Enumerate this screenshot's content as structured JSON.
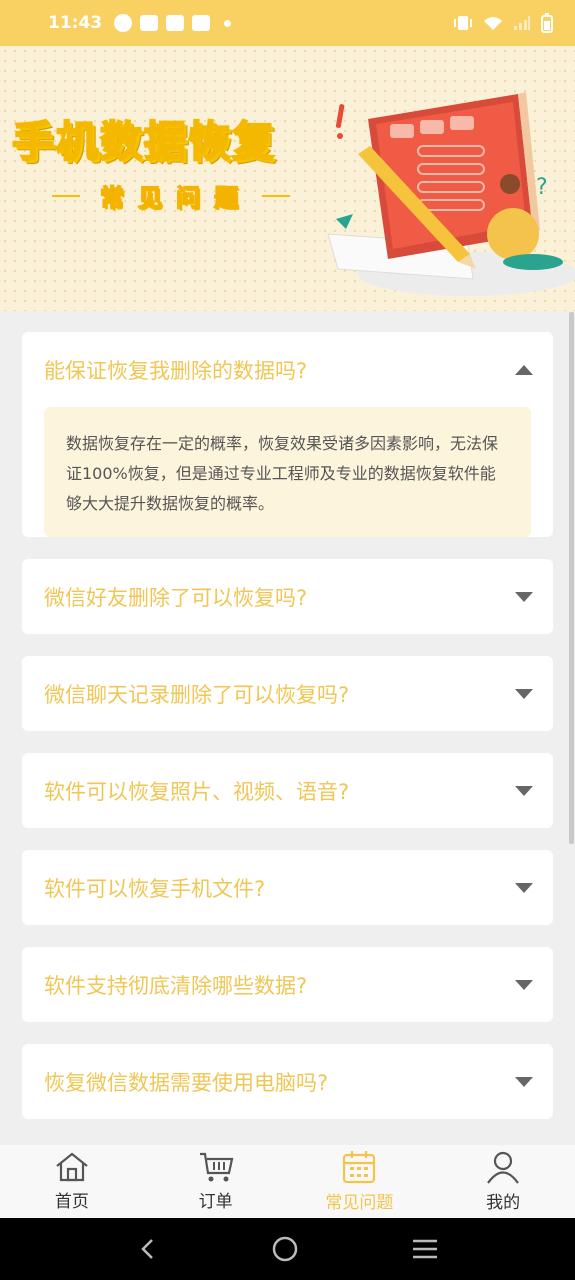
{
  "status_bar": {
    "time": "11:43"
  },
  "banner": {
    "title": "手机数据恢复",
    "subtitle": "常见问题"
  },
  "faq": [
    {
      "question": "能保证恢复我删除的数据吗?",
      "expanded": true,
      "answer": "数据恢复存在一定的概率，恢复效果受诸多因素影响，无法保证100%恢复，但是通过专业工程师及专业的数据恢复软件能够大大提升数据恢复的概率。"
    },
    {
      "question": "微信好友删除了可以恢复吗?",
      "expanded": false
    },
    {
      "question": "微信聊天记录删除了可以恢复吗?",
      "expanded": false
    },
    {
      "question": "软件可以恢复照片、视频、语音?",
      "expanded": false
    },
    {
      "question": "软件可以恢复手机文件?",
      "expanded": false
    },
    {
      "question": "软件支持彻底清除哪些数据?",
      "expanded": false
    },
    {
      "question": "恢复微信数据需要使用电脑吗?",
      "expanded": false
    }
  ],
  "tabbar": {
    "items": [
      {
        "label": "首页",
        "icon": "home-icon",
        "active": false
      },
      {
        "label": "订单",
        "icon": "cart-icon",
        "active": false
      },
      {
        "label": "常见问题",
        "icon": "calendar-icon",
        "active": true
      },
      {
        "label": "我的",
        "icon": "user-icon",
        "active": false
      }
    ]
  },
  "colors": {
    "accent": "#f9d062",
    "question_text": "#f0c654",
    "answer_bg": "#fdf4dc"
  }
}
